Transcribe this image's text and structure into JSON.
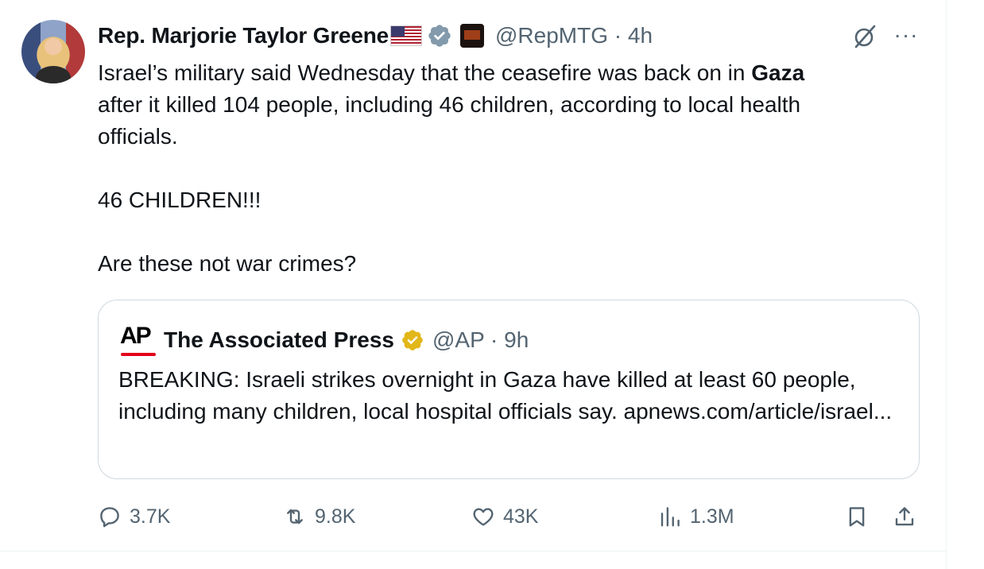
{
  "tweet": {
    "author_name": "Rep. Marjorie Taylor Greene",
    "handle": "@RepMTG",
    "time": "· 4h",
    "text_before_bold": "Israel’s military said Wednesday that the ceasefire was back on in ",
    "text_bold": "Gaza",
    "text_after_bold": "\nafter it killed 104 people, including 46 children, according to local health\nofficials.\n\n46 CHILDREN!!!\n\nAre these not war crimes?"
  },
  "quote": {
    "logo_text": "AP",
    "author_name": "The Associated Press",
    "handle": "@AP",
    "time": "· 9h",
    "text": "BREAKING: Israeli strikes overnight in Gaza have killed at least 60 people, including many children, local hospital officials say. apnews.com/article/israel..."
  },
  "actions": {
    "replies": "3.7K",
    "reposts": "9.8K",
    "likes": "43K",
    "views": "1.3M"
  },
  "icons": {
    "verified_gray": "verified-badge-gray",
    "verified_gold": "verified-badge-gold",
    "grok": "grok-icon",
    "more": "more-icon",
    "reply": "reply-icon",
    "repost": "repost-icon",
    "like": "heart-icon",
    "views": "views-icon",
    "bookmark": "bookmark-icon",
    "share": "share-icon"
  },
  "colors": {
    "text": "#0f1419",
    "secondary": "#536471",
    "border": "#cfd9de",
    "ap_red": "#e3001b",
    "verified_gold": "#e2b719"
  }
}
